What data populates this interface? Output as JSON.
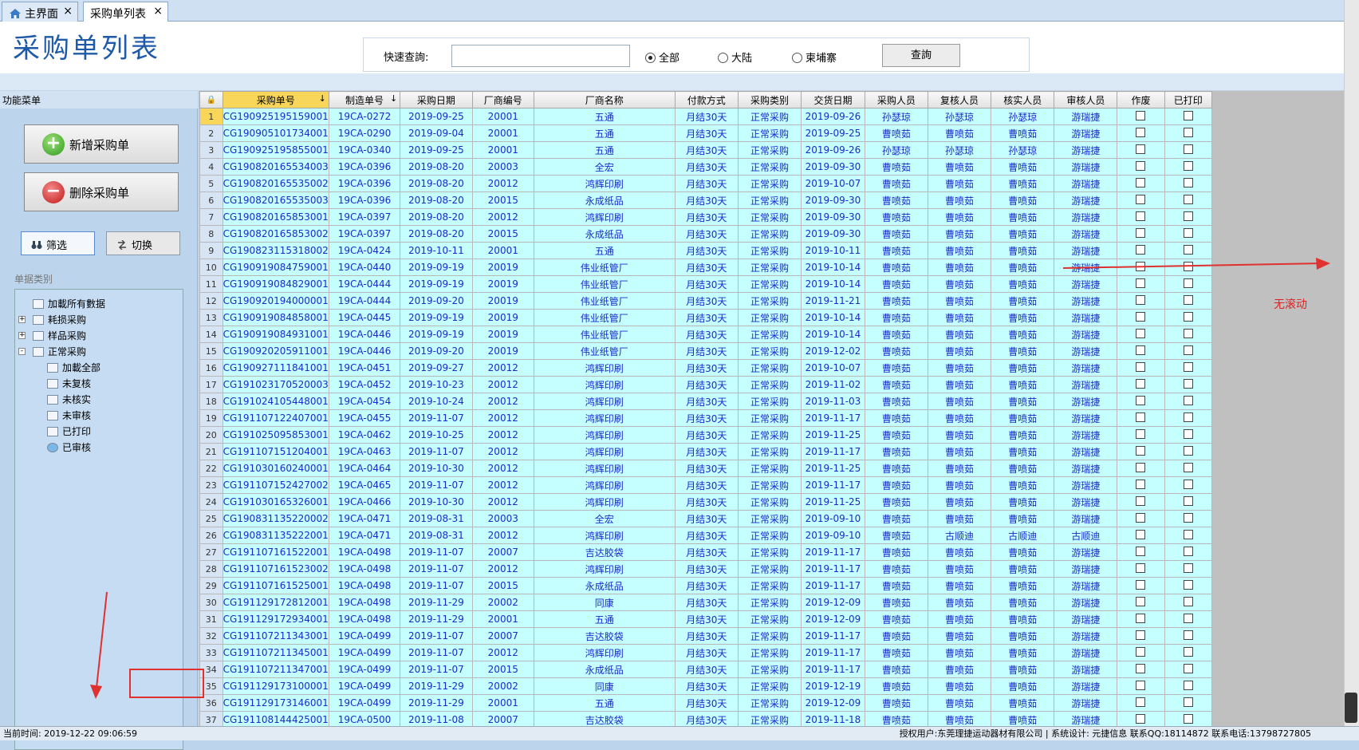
{
  "tabs": [
    {
      "label": "主界面",
      "close": "×"
    },
    {
      "label": "采购单列表",
      "close": "×"
    }
  ],
  "page_title": "采购单列表",
  "search": {
    "label": "快速查詢:",
    "value": "",
    "radios": [
      {
        "label": "全部",
        "checked": true
      },
      {
        "label": "大陆",
        "checked": false
      },
      {
        "label": "柬埔寨",
        "checked": false
      }
    ],
    "button": "查詢"
  },
  "left": {
    "menu_title": "功能菜单",
    "add_btn": "新增采购单",
    "delete_btn": "删除采购单",
    "filter_btn": "筛选",
    "switch_btn": "切换",
    "category_title": "单据类别",
    "tree": [
      {
        "label": "加載所有數据",
        "level": 0,
        "expand": ""
      },
      {
        "label": "耗损采购",
        "level": 0,
        "expand": "+"
      },
      {
        "label": "样品采购",
        "level": 0,
        "expand": "+"
      },
      {
        "label": "正常采购",
        "level": 0,
        "expand": "-"
      },
      {
        "label": "加載全部",
        "level": 1,
        "expand": ""
      },
      {
        "label": "未复核",
        "level": 1,
        "expand": ""
      },
      {
        "label": "未核实",
        "level": 1,
        "expand": ""
      },
      {
        "label": "未审核",
        "level": 1,
        "expand": ""
      },
      {
        "label": "已打印",
        "level": 1,
        "expand": ""
      },
      {
        "label": "已审核",
        "level": 1,
        "expand": ""
      }
    ]
  },
  "grid": {
    "header_icon": "lock-icon",
    "columns": [
      "采购单号",
      "制造单号",
      "采购日期",
      "厂商编号",
      "厂商名称",
      "付款方式",
      "采购类别",
      "交货日期",
      "采购人员",
      "复核人员",
      "核实人员",
      "审核人员",
      "作废",
      "已打印"
    ],
    "rows": [
      [
        "1",
        "CG190925195159001",
        "19CA-0272",
        "2019-09-25",
        "20001",
        "五通",
        "月结30天",
        "正常采购",
        "2019-09-26",
        "孙瑟琼",
        "孙瑟琼",
        "孙瑟琼",
        "游瑞捷"
      ],
      [
        "2",
        "CG190905101734001",
        "19CA-0290",
        "2019-09-04",
        "20001",
        "五通",
        "月结30天",
        "正常采购",
        "2019-09-25",
        "曹喷茹",
        "曹喷茹",
        "曹喷茹",
        "游瑞捷"
      ],
      [
        "3",
        "CG190925195855001",
        "19CA-0340",
        "2019-09-25",
        "20001",
        "五通",
        "月结30天",
        "正常采购",
        "2019-09-26",
        "孙瑟琼",
        "孙瑟琼",
        "孙瑟琼",
        "游瑞捷"
      ],
      [
        "4",
        "CG190820165534003",
        "19CA-0396",
        "2019-08-20",
        "20003",
        "全宏",
        "月结30天",
        "正常采购",
        "2019-09-30",
        "曹喷茹",
        "曹喷茹",
        "曹喷茹",
        "游瑞捷"
      ],
      [
        "5",
        "CG190820165535002",
        "19CA-0396",
        "2019-08-20",
        "20012",
        "鸿辉印刷",
        "月结30天",
        "正常采购",
        "2019-10-07",
        "曹喷茹",
        "曹喷茹",
        "曹喷茹",
        "游瑞捷"
      ],
      [
        "6",
        "CG190820165535003",
        "19CA-0396",
        "2019-08-20",
        "20015",
        "永成纸品",
        "月结30天",
        "正常采购",
        "2019-09-30",
        "曹喷茹",
        "曹喷茹",
        "曹喷茹",
        "游瑞捷"
      ],
      [
        "7",
        "CG190820165853001",
        "19CA-0397",
        "2019-08-20",
        "20012",
        "鸿辉印刷",
        "月结30天",
        "正常采购",
        "2019-09-30",
        "曹喷茹",
        "曹喷茹",
        "曹喷茹",
        "游瑞捷"
      ],
      [
        "8",
        "CG190820165853002",
        "19CA-0397",
        "2019-08-20",
        "20015",
        "永成纸品",
        "月结30天",
        "正常采购",
        "2019-09-30",
        "曹喷茹",
        "曹喷茹",
        "曹喷茹",
        "游瑞捷"
      ],
      [
        "9",
        "CG190823115318002",
        "19CA-0424",
        "2019-10-11",
        "20001",
        "五通",
        "月结30天",
        "正常采购",
        "2019-10-11",
        "曹喷茹",
        "曹喷茹",
        "曹喷茹",
        "游瑞捷"
      ],
      [
        "10",
        "CG190919084759001",
        "19CA-0440",
        "2019-09-19",
        "20019",
        "伟业纸管厂",
        "月结30天",
        "正常采购",
        "2019-10-14",
        "曹喷茹",
        "曹喷茹",
        "曹喷茹",
        "游瑞捷"
      ],
      [
        "11",
        "CG190919084829001",
        "19CA-0444",
        "2019-09-19",
        "20019",
        "伟业纸管厂",
        "月结30天",
        "正常采购",
        "2019-10-14",
        "曹喷茹",
        "曹喷茹",
        "曹喷茹",
        "游瑞捷"
      ],
      [
        "12",
        "CG190920194000001",
        "19CA-0444",
        "2019-09-20",
        "20019",
        "伟业纸管厂",
        "月结30天",
        "正常采购",
        "2019-11-21",
        "曹喷茹",
        "曹喷茹",
        "曹喷茹",
        "游瑞捷"
      ],
      [
        "13",
        "CG190919084858001",
        "19CA-0445",
        "2019-09-19",
        "20019",
        "伟业纸管厂",
        "月结30天",
        "正常采购",
        "2019-10-14",
        "曹喷茹",
        "曹喷茹",
        "曹喷茹",
        "游瑞捷"
      ],
      [
        "14",
        "CG190919084931001",
        "19CA-0446",
        "2019-09-19",
        "20019",
        "伟业纸管厂",
        "月结30天",
        "正常采购",
        "2019-10-14",
        "曹喷茹",
        "曹喷茹",
        "曹喷茹",
        "游瑞捷"
      ],
      [
        "15",
        "CG190920205911001",
        "19CA-0446",
        "2019-09-20",
        "20019",
        "伟业纸管厂",
        "月结30天",
        "正常采购",
        "2019-12-02",
        "曹喷茹",
        "曹喷茹",
        "曹喷茹",
        "游瑞捷"
      ],
      [
        "16",
        "CG190927111841001",
        "19CA-0451",
        "2019-09-27",
        "20012",
        "鸿辉印刷",
        "月结30天",
        "正常采购",
        "2019-10-07",
        "曹喷茹",
        "曹喷茹",
        "曹喷茹",
        "游瑞捷"
      ],
      [
        "17",
        "CG191023170520003",
        "19CA-0452",
        "2019-10-23",
        "20012",
        "鸿辉印刷",
        "月结30天",
        "正常采购",
        "2019-11-02",
        "曹喷茹",
        "曹喷茹",
        "曹喷茹",
        "游瑞捷"
      ],
      [
        "18",
        "CG191024105448001",
        "19CA-0454",
        "2019-10-24",
        "20012",
        "鸿辉印刷",
        "月结30天",
        "正常采购",
        "2019-11-03",
        "曹喷茹",
        "曹喷茹",
        "曹喷茹",
        "游瑞捷"
      ],
      [
        "19",
        "CG191107122407001",
        "19CA-0455",
        "2019-11-07",
        "20012",
        "鸿辉印刷",
        "月结30天",
        "正常采购",
        "2019-11-17",
        "曹喷茹",
        "曹喷茹",
        "曹喷茹",
        "游瑞捷"
      ],
      [
        "20",
        "CG191025095853001",
        "19CA-0462",
        "2019-10-25",
        "20012",
        "鸿辉印刷",
        "月结30天",
        "正常采购",
        "2019-11-25",
        "曹喷茹",
        "曹喷茹",
        "曹喷茹",
        "游瑞捷"
      ],
      [
        "21",
        "CG191107151204001",
        "19CA-0463",
        "2019-11-07",
        "20012",
        "鸿辉印刷",
        "月结30天",
        "正常采购",
        "2019-11-17",
        "曹喷茹",
        "曹喷茹",
        "曹喷茹",
        "游瑞捷"
      ],
      [
        "22",
        "CG191030160240001",
        "19CA-0464",
        "2019-10-30",
        "20012",
        "鸿辉印刷",
        "月结30天",
        "正常采购",
        "2019-11-25",
        "曹喷茹",
        "曹喷茹",
        "曹喷茹",
        "游瑞捷"
      ],
      [
        "23",
        "CG191107152427002",
        "19CA-0465",
        "2019-11-07",
        "20012",
        "鸿辉印刷",
        "月结30天",
        "正常采购",
        "2019-11-17",
        "曹喷茹",
        "曹喷茹",
        "曹喷茹",
        "游瑞捷"
      ],
      [
        "24",
        "CG191030165326001",
        "19CA-0466",
        "2019-10-30",
        "20012",
        "鸿辉印刷",
        "月结30天",
        "正常采购",
        "2019-11-25",
        "曹喷茹",
        "曹喷茹",
        "曹喷茹",
        "游瑞捷"
      ],
      [
        "25",
        "CG190831135220002",
        "19CA-0471",
        "2019-08-31",
        "20003",
        "全宏",
        "月结30天",
        "正常采购",
        "2019-09-10",
        "曹喷茹",
        "曹喷茹",
        "曹喷茹",
        "游瑞捷"
      ],
      [
        "26",
        "CG190831135222001",
        "19CA-0471",
        "2019-08-31",
        "20012",
        "鸿辉印刷",
        "月结30天",
        "正常采购",
        "2019-09-10",
        "曹喷茹",
        "古顺迪",
        "古顺迪",
        "古顺迪"
      ],
      [
        "27",
        "CG191107161522001",
        "19CA-0498",
        "2019-11-07",
        "20007",
        "吉达胶袋",
        "月结30天",
        "正常采购",
        "2019-11-17",
        "曹喷茹",
        "曹喷茹",
        "曹喷茹",
        "游瑞捷"
      ],
      [
        "28",
        "CG191107161523002",
        "19CA-0498",
        "2019-11-07",
        "20012",
        "鸿辉印刷",
        "月结30天",
        "正常采购",
        "2019-11-17",
        "曹喷茹",
        "曹喷茹",
        "曹喷茹",
        "游瑞捷"
      ],
      [
        "29",
        "CG191107161525001",
        "19CA-0498",
        "2019-11-07",
        "20015",
        "永成纸品",
        "月结30天",
        "正常采购",
        "2019-11-17",
        "曹喷茹",
        "曹喷茹",
        "曹喷茹",
        "游瑞捷"
      ],
      [
        "30",
        "CG191129172812001",
        "19CA-0498",
        "2019-11-29",
        "20002",
        "同康",
        "月结30天",
        "正常采购",
        "2019-12-09",
        "曹喷茹",
        "曹喷茹",
        "曹喷茹",
        "游瑞捷"
      ],
      [
        "31",
        "CG191129172934001",
        "19CA-0498",
        "2019-11-29",
        "20001",
        "五通",
        "月结30天",
        "正常采购",
        "2019-12-09",
        "曹喷茹",
        "曹喷茹",
        "曹喷茹",
        "游瑞捷"
      ],
      [
        "32",
        "CG191107211343001",
        "19CA-0499",
        "2019-11-07",
        "20007",
        "吉达胶袋",
        "月结30天",
        "正常采购",
        "2019-11-17",
        "曹喷茹",
        "曹喷茹",
        "曹喷茹",
        "游瑞捷"
      ],
      [
        "33",
        "CG191107211345001",
        "19CA-0499",
        "2019-11-07",
        "20012",
        "鸿辉印刷",
        "月结30天",
        "正常采购",
        "2019-11-17",
        "曹喷茹",
        "曹喷茹",
        "曹喷茹",
        "游瑞捷"
      ],
      [
        "34",
        "CG191107211347001",
        "19CA-0499",
        "2019-11-07",
        "20015",
        "永成纸品",
        "月结30天",
        "正常采购",
        "2019-11-17",
        "曹喷茹",
        "曹喷茹",
        "曹喷茹",
        "游瑞捷"
      ],
      [
        "35",
        "CG191129173100001",
        "19CA-0499",
        "2019-11-29",
        "20002",
        "同康",
        "月结30天",
        "正常采购",
        "2019-12-19",
        "曹喷茹",
        "曹喷茹",
        "曹喷茹",
        "游瑞捷"
      ],
      [
        "36",
        "CG191129173146001",
        "19CA-0499",
        "2019-11-29",
        "20001",
        "五通",
        "月结30天",
        "正常采购",
        "2019-12-09",
        "曹喷茹",
        "曹喷茹",
        "曹喷茹",
        "游瑞捷"
      ],
      [
        "37",
        "CG191108144425001",
        "19CA-0500",
        "2019-11-08",
        "20007",
        "吉达胶袋",
        "月结30天",
        "正常采购",
        "2019-11-18",
        "曹喷茹",
        "曹喷茹",
        "曹喷茹",
        "游瑞捷"
      ]
    ]
  },
  "annotation": "无滚动",
  "status": {
    "left": "当前时间: 2019-12-22 09:06:59",
    "right": "授权用户:东莞理捷运动器材有限公司 | 系统设计: 元捷信息   联系QQ:18114872   联系电话:13798727805"
  }
}
